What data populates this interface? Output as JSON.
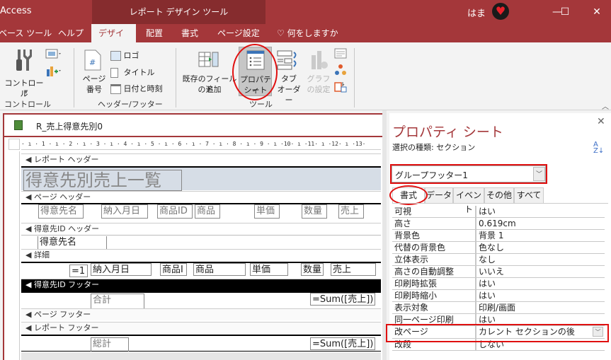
{
  "titlebar": {
    "app_name": "Access",
    "context_title": "レポート デザイン ツール",
    "user_name": "はま",
    "avatar_icon": "heart-avatar",
    "minimize": "—",
    "maximize": "☐",
    "close": "✕"
  },
  "tabs": [
    {
      "label": "ベース ツール"
    },
    {
      "label": "ヘルプ"
    },
    {
      "label": "デザイン",
      "active": true
    },
    {
      "label": "配置"
    },
    {
      "label": "書式"
    },
    {
      "label": "ページ設定"
    }
  ],
  "tell_me": {
    "icon": "lightbulb-icon",
    "label": "何をしますか"
  },
  "ribbon": {
    "groups": [
      {
        "label": "コントロール",
        "buttons": [
          {
            "label": "コントロール",
            "icon": "tools-icon"
          }
        ]
      },
      {
        "label": "ヘッダー/フッター",
        "buttons": [
          {
            "label": "ページ\n番号",
            "line1": "ページ",
            "line2": "番号",
            "icon": "page-number-icon"
          },
          {
            "label": "ロゴ",
            "icon": "logo-icon"
          },
          {
            "label": "タイトル",
            "icon": "title-icon"
          },
          {
            "label": "日付と時刻",
            "icon": "date-time-icon"
          }
        ]
      },
      {
        "label": "ツール",
        "buttons": [
          {
            "label": "既存のフィールドの追加",
            "line1": "既存のフィールド",
            "line2": "の追加",
            "icon": "add-fields-icon"
          },
          {
            "label": "プロパティシート",
            "line1": "プロパティ",
            "line2": "シート",
            "icon": "property-sheet-icon",
            "active": true
          },
          {
            "label": "タブオーダー",
            "line1": "タブ",
            "line2": "オーダー",
            "icon": "tab-order-icon"
          },
          {
            "label": "グラフの設定",
            "line1": "グラフ",
            "line2": "の設定",
            "icon": "chart-settings-icon",
            "disabled": true
          }
        ]
      }
    ]
  },
  "document": {
    "title": "R_売上得意先別0",
    "ruler": "· ı · 1 · ı · 2 · ı · 3 · ı · 4 · ı · 5 · ı · 6 · ı · 7 · ı · 8 · ı · 9 · ı ·10· ı ·11· ı ·12· ı ·13·",
    "sections": {
      "report_header": "レポート ヘッダー",
      "page_header": "ページ ヘッダー",
      "group_header": "得意先ID ヘッダー",
      "detail": "詳細",
      "group_footer": "得意先ID フッター",
      "page_footer": "ページ フッター",
      "report_footer": "レポート フッター"
    },
    "report_title": "得意先別売上一覧",
    "page_header_labels": [
      "得意先名",
      "納入月日",
      "商品ID",
      "商品",
      "単価",
      "数量",
      "売上"
    ],
    "group_header_field": "得意先名",
    "detail_fields": [
      "=1",
      "納入月日",
      "商品I",
      "商品",
      "単価",
      "数量",
      "売上"
    ],
    "group_footer_label": "合計",
    "group_footer_expr": "=Sum([売上])",
    "report_footer_label": "総計",
    "report_footer_expr": "=Sum([売上])"
  },
  "property_sheet": {
    "title": "プロパティ シート",
    "selection_type": "選択の種類: セクション",
    "sort_icon": "A↓Z",
    "selected_object": "グループフッター1",
    "tabs": [
      "書式",
      "データ",
      "イベント",
      "その他",
      "すべて"
    ],
    "active_tab": "書式",
    "properties": [
      {
        "name": "可視",
        "value": "はい"
      },
      {
        "name": "高さ",
        "value": "0.619cm"
      },
      {
        "name": "背景色",
        "value": "背景 1"
      },
      {
        "name": "代替の背景色",
        "value": "色なし"
      },
      {
        "name": "立体表示",
        "value": "なし"
      },
      {
        "name": "高さの自動調整",
        "value": "いいえ"
      },
      {
        "name": "印刷時拡張",
        "value": "はい"
      },
      {
        "name": "印刷時縮小",
        "value": "はい"
      },
      {
        "name": "表示対象",
        "value": "印刷/画面"
      },
      {
        "name": "同一ページ印刷",
        "value": "はい"
      },
      {
        "name": "改ページ",
        "value": "カレント セクションの後",
        "highlighted": true
      },
      {
        "name": "改段",
        "value": "しない"
      }
    ]
  },
  "colors": {
    "accent": "#a4373a",
    "context_tab": "#862c2e",
    "annotation": "#e01010"
  }
}
